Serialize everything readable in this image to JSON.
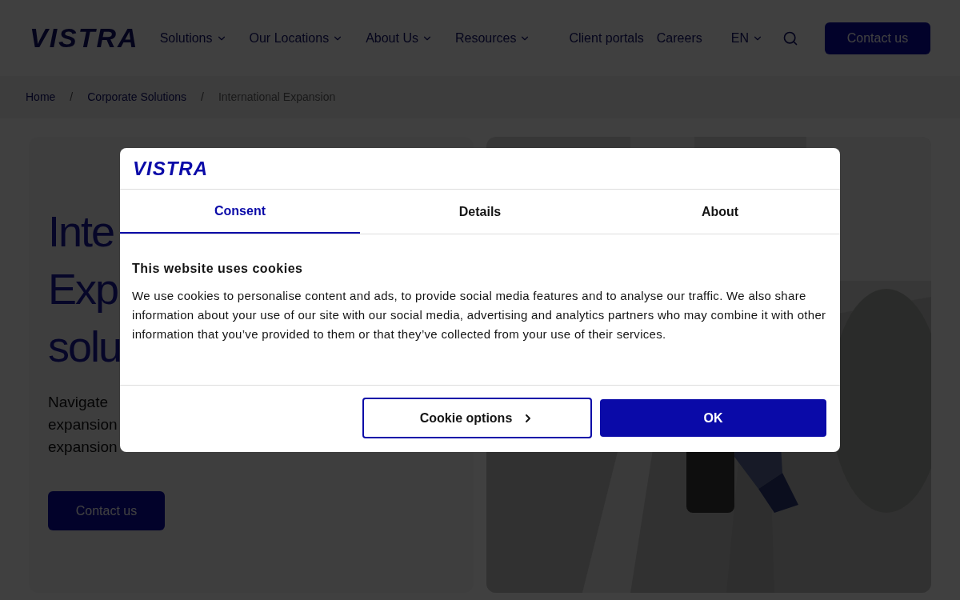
{
  "header": {
    "logo": "VISTRA",
    "nav": [
      {
        "label": "Solutions",
        "dropdown": true
      },
      {
        "label": "Our Locations",
        "dropdown": true
      },
      {
        "label": "About Us",
        "dropdown": true
      },
      {
        "label": "Resources",
        "dropdown": true
      }
    ],
    "links": [
      "Client portals",
      "Careers"
    ],
    "language": "EN",
    "cta": "Contact us"
  },
  "breadcrumb": [
    {
      "label": "Home",
      "current": false
    },
    {
      "label": "Corporate Solutions",
      "current": false
    },
    {
      "label": "International Expansion",
      "current": true
    }
  ],
  "breadcrumb_separator": "/",
  "hero": {
    "title_lines": [
      "Inte",
      "Exp",
      "solu"
    ],
    "description_lines": [
      "Navigate",
      "expansion",
      "expansion"
    ],
    "cta": "Contact us",
    "image": {
      "kind": "picture"
    }
  },
  "cookie_dialog": {
    "logo": "VISTRA",
    "tabs": [
      {
        "label": "Consent",
        "selected": true
      },
      {
        "label": "Details",
        "selected": false
      },
      {
        "label": "About",
        "selected": false
      }
    ],
    "heading": "This website uses cookies",
    "body": "We use cookies to personalise content and ads, to provide social media features and to analyse our traffic. We also share information about your use of our site with our social media, advertising and analytics partners who may combine it with other information that you’ve provided to them or that they’ve collected from your use of their services.",
    "buttons": [
      {
        "label": "Cookie options",
        "kind": "outline"
      },
      {
        "label": "OK",
        "kind": "primary"
      }
    ]
  }
}
